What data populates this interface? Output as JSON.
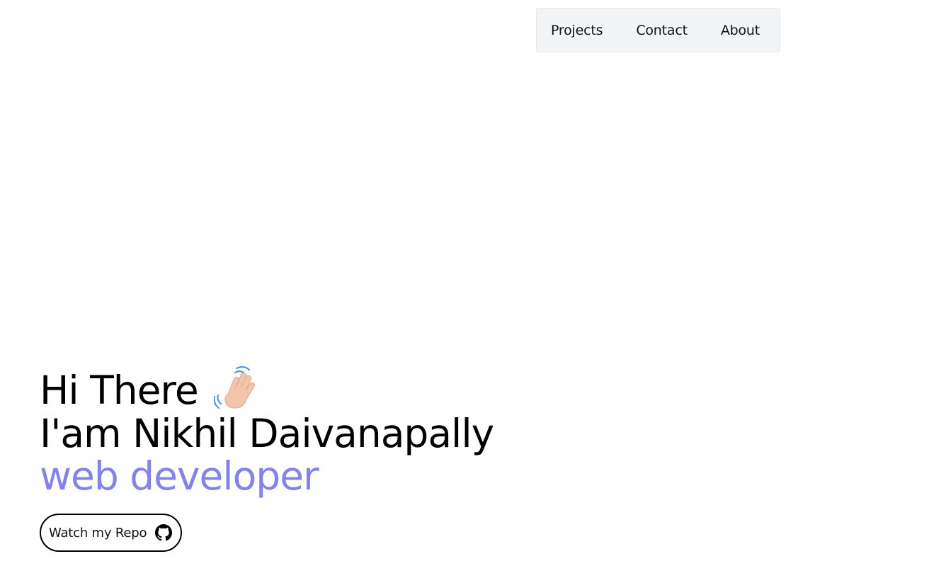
{
  "nav": {
    "items": [
      {
        "label": "Projects"
      },
      {
        "label": "Contact"
      },
      {
        "label": "About"
      }
    ]
  },
  "hero": {
    "greeting": "Hi There",
    "greeting_icon": "waving-hand-icon",
    "name_line": "I'am Nikhil Daivanapally",
    "role": "web developer",
    "role_color": "#8382f2"
  },
  "repo_button": {
    "label": "Watch my Repo",
    "icon": "github-icon"
  }
}
